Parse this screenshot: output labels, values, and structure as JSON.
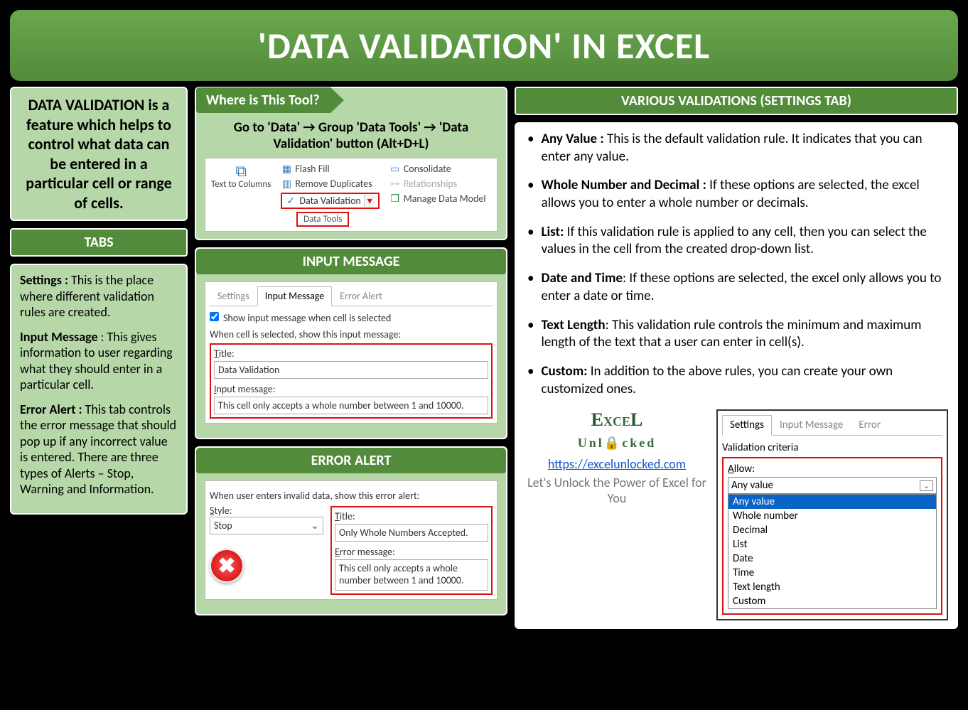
{
  "header": {
    "title": "'DATA VALIDATION' IN EXCEL"
  },
  "intro": "DATA VALIDATION is a feature which helps to control what data can be entered in a particular cell or range of cells.",
  "tabs_title": "TABS",
  "tabs": {
    "settings_b": "Settings :",
    "settings_t": " This is the place where different validation rules are created.",
    "input_b": "Input Message",
    "input_t": " : This gives information to user regarding what they should enter in a particular cell.",
    "error_b": "Error Alert :",
    "error_t": " This tab controls the error message that should pop up if any incorrect value is entered. There are three types of Alerts – Stop, Warning and Information."
  },
  "where": {
    "heading": "Where is This Tool?",
    "path": "Go to 'Data' → Group 'Data Tools' → 'Data Validation' button (Alt+D+L)",
    "text_to_columns": "Text to Columns",
    "flash_fill": "Flash Fill",
    "remove_dup": "Remove Duplicates",
    "data_validation": "Data Validation",
    "consolidate": "Consolidate",
    "relationships": "Relationships",
    "manage_dm": "Manage Data Model",
    "group": "Data Tools"
  },
  "input_msg": {
    "title": "INPUT MESSAGE",
    "tab_settings": "Settings",
    "tab_input": "Input Message",
    "tab_error": "Error Alert",
    "chk": "Show input message when cell is selected",
    "when": "When cell is selected, show this input message:",
    "t_lbl": "Title:",
    "t_val": "Data Validation",
    "m_lbl": "Input message:",
    "m_val": "This cell only accepts a whole number between 1 and 10000."
  },
  "error_alert": {
    "title": "ERROR ALERT",
    "when": "When user enters invalid data, show this error alert:",
    "style_lbl": "Style:",
    "style_val": "Stop",
    "t_lbl": "Title:",
    "t_val": "Only Whole Numbers Accepted.",
    "m_lbl": "Error message:",
    "m_val": "This cell only accepts a whole number between 1 and 10000."
  },
  "various": {
    "title": "VARIOUS VALIDATIONS (SETTINGS TAB)",
    "items": [
      {
        "b": "Any Value :",
        "t": "  This is the default validation rule. It indicates that you can enter any value."
      },
      {
        "b": "Whole Number and Decimal :",
        "t": " If these options are selected, the excel allows you to enter a whole number or decimals."
      },
      {
        "b": "List:",
        "t": " If this validation rule is applied to any cell, then you can select the values in the cell from the created drop-down list."
      },
      {
        "b": "Date and Time",
        "t": ": If these options are selected, the excel only allows you to enter a date or time."
      },
      {
        "b": "Text Length",
        "t": ": This validation rule controls the minimum and maximum length of the text that a user can enter in cell(s)."
      },
      {
        "b": "Custom:",
        "t": " In addition to the above rules, you can create your own customized ones."
      }
    ]
  },
  "brand": {
    "url": "https://excelunlocked.com",
    "tag": "Let's Unlock the Power of Excel for You"
  },
  "settings_popup": {
    "tab_settings": "Settings",
    "tab_input": "Input Message",
    "tab_error": "Error",
    "vc": "Validation criteria",
    "allow_lbl": "Allow:",
    "allow_val": "Any value",
    "options": [
      "Any value",
      "Whole number",
      "Decimal",
      "List",
      "Date",
      "Time",
      "Text length",
      "Custom"
    ]
  }
}
